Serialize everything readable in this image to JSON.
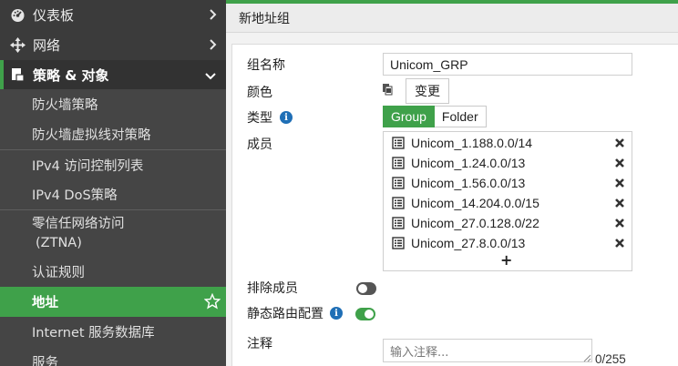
{
  "sidebar": {
    "top_items": [
      {
        "label": "仪表板",
        "icon": "dashboard-icon"
      },
      {
        "label": "网络",
        "icon": "network-arrows-icon"
      }
    ],
    "category": {
      "label": "策略 & 对象",
      "icon": "policy-document-icon"
    },
    "sub_items": [
      {
        "label": "防火墙策略"
      },
      {
        "label": "防火墙虚拟线对策略"
      },
      {
        "label": "IPv4 访问控制列表"
      },
      {
        "label": "IPv4 DoS策略"
      },
      {
        "label_line1": "零信任网络访问",
        "label_line2": "(ZTNA)"
      },
      {
        "label": "认证规则"
      },
      {
        "label": "地址",
        "active": true
      },
      {
        "label": "Internet 服务数据库"
      },
      {
        "label": "服务"
      }
    ]
  },
  "page": {
    "title": "新地址组"
  },
  "form": {
    "name_label": "组名称",
    "name_value": "Unicom_GRP",
    "color_label": "颜色",
    "change_button": "变更",
    "type_label": "类型",
    "type_options": [
      "Group",
      "Folder"
    ],
    "type_selected": "Group",
    "members_label": "成员",
    "members": [
      "Unicom_1.188.0.0/14",
      "Unicom_1.24.0.0/13",
      "Unicom_1.56.0.0/13",
      "Unicom_14.204.0.0/15",
      "Unicom_27.0.128.0/22",
      "Unicom_27.8.0.0/13"
    ],
    "add_symbol": "+",
    "exclude_label": "排除成员",
    "exclude_enabled": false,
    "static_route_label": "静态路由配置",
    "static_route_enabled": true,
    "comment_label": "注释",
    "comment_placeholder": "输入注释...",
    "comment_counter": "0/255"
  },
  "colors": {
    "accent": "#3fa14a",
    "sidebar_bg": "#3b3b3b",
    "info": "#1f6fb6"
  }
}
